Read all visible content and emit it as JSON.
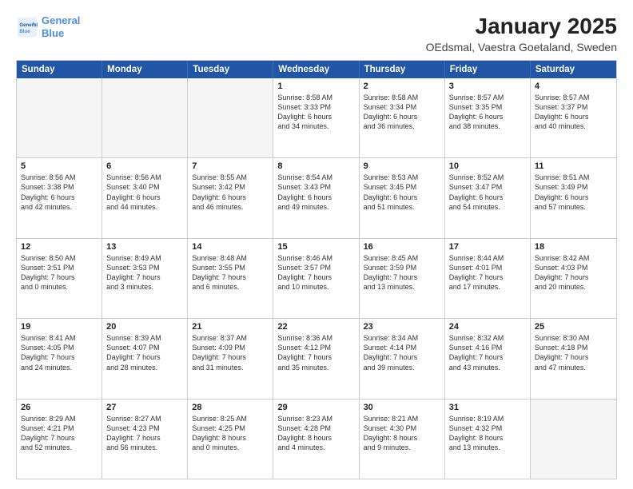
{
  "header": {
    "logo_line1": "General",
    "logo_line2": "Blue",
    "title": "January 2025",
    "subtitle": "OEdsmal, Vaestra Goetaland, Sweden"
  },
  "calendar": {
    "days_of_week": [
      "Sunday",
      "Monday",
      "Tuesday",
      "Wednesday",
      "Thursday",
      "Friday",
      "Saturday"
    ],
    "rows": [
      [
        {
          "day": "",
          "lines": [],
          "empty": true
        },
        {
          "day": "",
          "lines": [],
          "empty": true
        },
        {
          "day": "",
          "lines": [],
          "empty": true
        },
        {
          "day": "1",
          "lines": [
            "Sunrise: 8:58 AM",
            "Sunset: 3:33 PM",
            "Daylight: 6 hours",
            "and 34 minutes."
          ],
          "empty": false
        },
        {
          "day": "2",
          "lines": [
            "Sunrise: 8:58 AM",
            "Sunset: 3:34 PM",
            "Daylight: 6 hours",
            "and 36 minutes."
          ],
          "empty": false
        },
        {
          "day": "3",
          "lines": [
            "Sunrise: 8:57 AM",
            "Sunset: 3:35 PM",
            "Daylight: 6 hours",
            "and 38 minutes."
          ],
          "empty": false
        },
        {
          "day": "4",
          "lines": [
            "Sunrise: 8:57 AM",
            "Sunset: 3:37 PM",
            "Daylight: 6 hours",
            "and 40 minutes."
          ],
          "empty": false
        }
      ],
      [
        {
          "day": "5",
          "lines": [
            "Sunrise: 8:56 AM",
            "Sunset: 3:38 PM",
            "Daylight: 6 hours",
            "and 42 minutes."
          ],
          "empty": false
        },
        {
          "day": "6",
          "lines": [
            "Sunrise: 8:56 AM",
            "Sunset: 3:40 PM",
            "Daylight: 6 hours",
            "and 44 minutes."
          ],
          "empty": false
        },
        {
          "day": "7",
          "lines": [
            "Sunrise: 8:55 AM",
            "Sunset: 3:42 PM",
            "Daylight: 6 hours",
            "and 46 minutes."
          ],
          "empty": false
        },
        {
          "day": "8",
          "lines": [
            "Sunrise: 8:54 AM",
            "Sunset: 3:43 PM",
            "Daylight: 6 hours",
            "and 49 minutes."
          ],
          "empty": false
        },
        {
          "day": "9",
          "lines": [
            "Sunrise: 8:53 AM",
            "Sunset: 3:45 PM",
            "Daylight: 6 hours",
            "and 51 minutes."
          ],
          "empty": false
        },
        {
          "day": "10",
          "lines": [
            "Sunrise: 8:52 AM",
            "Sunset: 3:47 PM",
            "Daylight: 6 hours",
            "and 54 minutes."
          ],
          "empty": false
        },
        {
          "day": "11",
          "lines": [
            "Sunrise: 8:51 AM",
            "Sunset: 3:49 PM",
            "Daylight: 6 hours",
            "and 57 minutes."
          ],
          "empty": false
        }
      ],
      [
        {
          "day": "12",
          "lines": [
            "Sunrise: 8:50 AM",
            "Sunset: 3:51 PM",
            "Daylight: 7 hours",
            "and 0 minutes."
          ],
          "empty": false
        },
        {
          "day": "13",
          "lines": [
            "Sunrise: 8:49 AM",
            "Sunset: 3:53 PM",
            "Daylight: 7 hours",
            "and 3 minutes."
          ],
          "empty": false
        },
        {
          "day": "14",
          "lines": [
            "Sunrise: 8:48 AM",
            "Sunset: 3:55 PM",
            "Daylight: 7 hours",
            "and 6 minutes."
          ],
          "empty": false
        },
        {
          "day": "15",
          "lines": [
            "Sunrise: 8:46 AM",
            "Sunset: 3:57 PM",
            "Daylight: 7 hours",
            "and 10 minutes."
          ],
          "empty": false
        },
        {
          "day": "16",
          "lines": [
            "Sunrise: 8:45 AM",
            "Sunset: 3:59 PM",
            "Daylight: 7 hours",
            "and 13 minutes."
          ],
          "empty": false
        },
        {
          "day": "17",
          "lines": [
            "Sunrise: 8:44 AM",
            "Sunset: 4:01 PM",
            "Daylight: 7 hours",
            "and 17 minutes."
          ],
          "empty": false
        },
        {
          "day": "18",
          "lines": [
            "Sunrise: 8:42 AM",
            "Sunset: 4:03 PM",
            "Daylight: 7 hours",
            "and 20 minutes."
          ],
          "empty": false
        }
      ],
      [
        {
          "day": "19",
          "lines": [
            "Sunrise: 8:41 AM",
            "Sunset: 4:05 PM",
            "Daylight: 7 hours",
            "and 24 minutes."
          ],
          "empty": false
        },
        {
          "day": "20",
          "lines": [
            "Sunrise: 8:39 AM",
            "Sunset: 4:07 PM",
            "Daylight: 7 hours",
            "and 28 minutes."
          ],
          "empty": false
        },
        {
          "day": "21",
          "lines": [
            "Sunrise: 8:37 AM",
            "Sunset: 4:09 PM",
            "Daylight: 7 hours",
            "and 31 minutes."
          ],
          "empty": false
        },
        {
          "day": "22",
          "lines": [
            "Sunrise: 8:36 AM",
            "Sunset: 4:12 PM",
            "Daylight: 7 hours",
            "and 35 minutes."
          ],
          "empty": false
        },
        {
          "day": "23",
          "lines": [
            "Sunrise: 8:34 AM",
            "Sunset: 4:14 PM",
            "Daylight: 7 hours",
            "and 39 minutes."
          ],
          "empty": false
        },
        {
          "day": "24",
          "lines": [
            "Sunrise: 8:32 AM",
            "Sunset: 4:16 PM",
            "Daylight: 7 hours",
            "and 43 minutes."
          ],
          "empty": false
        },
        {
          "day": "25",
          "lines": [
            "Sunrise: 8:30 AM",
            "Sunset: 4:18 PM",
            "Daylight: 7 hours",
            "and 47 minutes."
          ],
          "empty": false
        }
      ],
      [
        {
          "day": "26",
          "lines": [
            "Sunrise: 8:29 AM",
            "Sunset: 4:21 PM",
            "Daylight: 7 hours",
            "and 52 minutes."
          ],
          "empty": false
        },
        {
          "day": "27",
          "lines": [
            "Sunrise: 8:27 AM",
            "Sunset: 4:23 PM",
            "Daylight: 7 hours",
            "and 56 minutes."
          ],
          "empty": false
        },
        {
          "day": "28",
          "lines": [
            "Sunrise: 8:25 AM",
            "Sunset: 4:25 PM",
            "Daylight: 8 hours",
            "and 0 minutes."
          ],
          "empty": false
        },
        {
          "day": "29",
          "lines": [
            "Sunrise: 8:23 AM",
            "Sunset: 4:28 PM",
            "Daylight: 8 hours",
            "and 4 minutes."
          ],
          "empty": false
        },
        {
          "day": "30",
          "lines": [
            "Sunrise: 8:21 AM",
            "Sunset: 4:30 PM",
            "Daylight: 8 hours",
            "and 9 minutes."
          ],
          "empty": false
        },
        {
          "day": "31",
          "lines": [
            "Sunrise: 8:19 AM",
            "Sunset: 4:32 PM",
            "Daylight: 8 hours",
            "and 13 minutes."
          ],
          "empty": false
        },
        {
          "day": "",
          "lines": [],
          "empty": true
        }
      ]
    ]
  }
}
